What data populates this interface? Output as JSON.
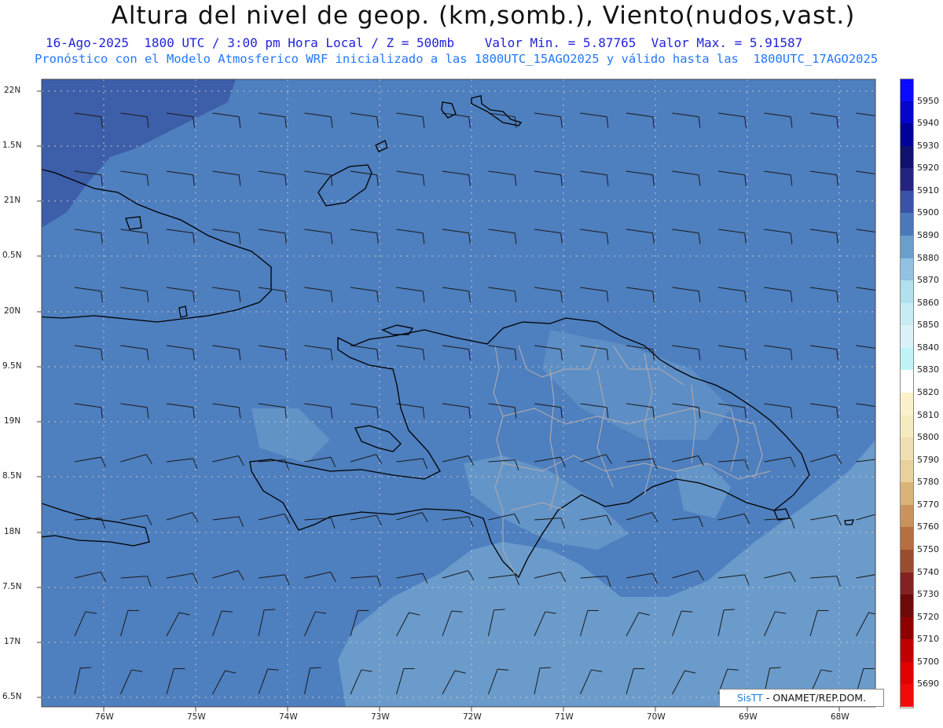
{
  "header": {
    "title": "Altura del nivel de geop. (km,somb.), Viento(nudos,vast.)",
    "line1": "16-Ago-2025  1800 UTC / 3:00 pm Hora Local / Z = 500mb    Valor Min. = 5.87765  Valor Max. = 5.91587",
    "line2": "Pronóstico con el Modelo Atmosferico WRF inicializado a las 1800UTC_15AGO2025 y válido hasta las  1800UTC_17AGO2025"
  },
  "axes": {
    "lat_labels": [
      "22N",
      "1.5N",
      "21N",
      "0.5N",
      "20N",
      "9.5N",
      "19N",
      "8.5N",
      "18N",
      "7.5N",
      "17N",
      "6.5N"
    ],
    "lon_labels": [
      "76W",
      "75W",
      "74W",
      "73W",
      "72W",
      "71W",
      "70W",
      "69W",
      "68W"
    ]
  },
  "colorbar": {
    "levels": [
      "5950",
      "5940",
      "5930",
      "5920",
      "5910",
      "5900",
      "5890",
      "5880",
      "5870",
      "5860",
      "5850",
      "5840",
      "5830",
      "5820",
      "5810",
      "5800",
      "5790",
      "5780",
      "5770",
      "5760",
      "5750",
      "5740",
      "5730",
      "5720",
      "5710",
      "5700",
      "5690"
    ],
    "colors": [
      "#0a0aff",
      "#0505cc",
      "#00009a",
      "#10106e",
      "#242480",
      "#3a52a8",
      "#4a78b8",
      "#6a9ecb",
      "#92c2df",
      "#b2e0ee",
      "#c8ecf4",
      "#daf2f8",
      "#c0f4f8",
      "#ffffff",
      "#fbf2cc",
      "#f6eac0",
      "#efdfb2",
      "#e8d19c",
      "#d8b478",
      "#c8945c",
      "#b46e40",
      "#9a4e30",
      "#822222",
      "#6e0a0a",
      "#8e0000",
      "#c00000",
      "#e00000",
      "#f00a0a"
    ]
  },
  "credit": {
    "sis": "SisTT",
    "text": " - ONAMET/REP.DOM."
  },
  "map_colors": {
    "field_main": "#4e7fbf",
    "field_dark": "#3d5ea9",
    "field_light": "#6a9bcb",
    "coast": "#000000",
    "province_border": "#a8a8b0",
    "grid": "#c8c8c8"
  }
}
